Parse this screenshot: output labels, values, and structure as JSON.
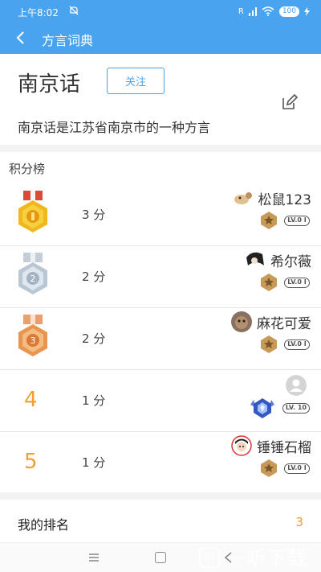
{
  "status_bar": {
    "time": "上午8:02",
    "signal_text": "R",
    "battery": "100"
  },
  "nav": {
    "title": "方言词典"
  },
  "dialect": {
    "name": "南京话",
    "follow_label": "关注",
    "description": "南京话是江苏省南京市的一种方言"
  },
  "leaderboard": {
    "title": "积分榜",
    "rows": [
      {
        "rank": "1",
        "score": "3 分",
        "username": "松鼠123",
        "level": "LV.0 I",
        "medal": "gold"
      },
      {
        "rank": "2",
        "score": "2 分",
        "username": "希尔薇",
        "level": "LV.0 I",
        "medal": "silver"
      },
      {
        "rank": "3",
        "score": "2 分",
        "username": "麻花可爱",
        "level": "LV.0 I",
        "medal": "bronze"
      },
      {
        "rank": "4",
        "score": "1 分",
        "username": "",
        "level": "LV. 10",
        "medal": ""
      },
      {
        "rank": "5",
        "score": "1 分",
        "username": "锤锤石榴",
        "level": "LV.0 I",
        "medal": ""
      }
    ]
  },
  "my_rank": {
    "label": "我的排名",
    "value": "3"
  },
  "watermark": {
    "text": "一听下载",
    "logo_char": "听"
  },
  "colors": {
    "primary": "#4aa3ee",
    "rank_orange": "#f0a030"
  }
}
